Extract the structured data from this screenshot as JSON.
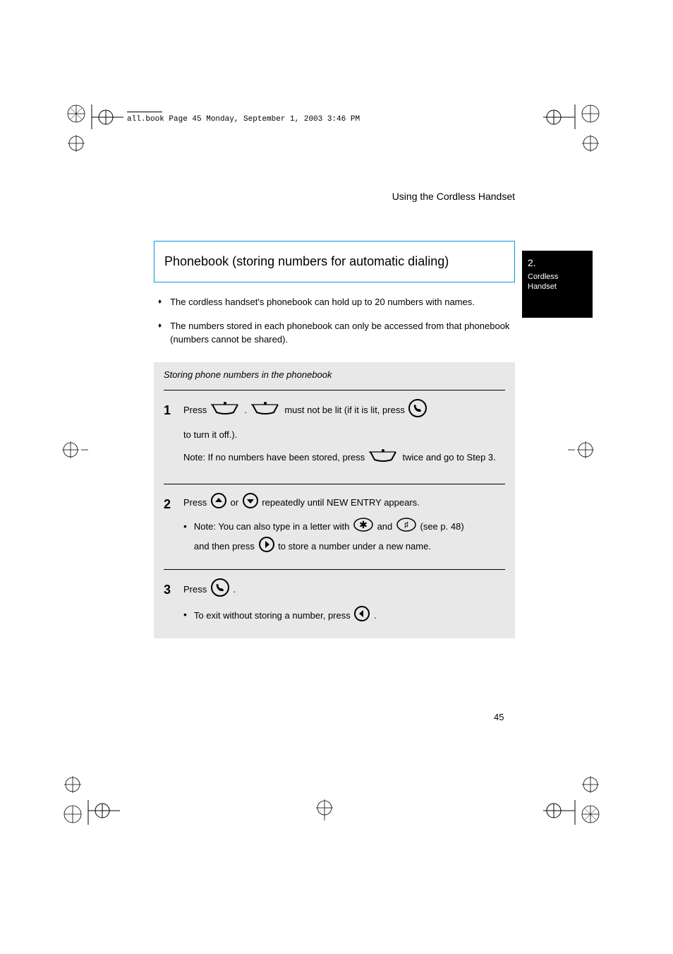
{
  "header": {
    "file_line": "all.book  Page 45  Monday, September 1, 2003  3:46 PM"
  },
  "running_header": "Using the Cordless Handset",
  "side_tab": {
    "number": "2.",
    "text": "Cordless Handset"
  },
  "section_title": "Phonebook (storing numbers for automatic dialing)",
  "bullets": [
    "The cordless handset's phonebook can hold up to 20 numbers with names.",
    "The numbers stored in each phonebook can only be accessed from that phonebook (numbers cannot be shared)."
  ],
  "gray_section": {
    "title": "Storing phone numbers in the phonebook",
    "step1": {
      "line1_a": "Press ",
      "line1_b": " .  ",
      "line1_c": " must not be lit (if it is lit, press ",
      "line1_d": "to turn it off.).",
      "line2_a": "Note: If no numbers have been stored, press ",
      "line2_b": " twice and go to Step 3."
    },
    "step2": {
      "line1_a": "Press ",
      "line1_b": " or ",
      "line1_c": " repeatedly until NEW ENTRY appears.",
      "sub_a": "Note: You can also type in a letter with ",
      "sub_b": " and ",
      "sub_c": " (see p. 48)",
      "sub2_a": "and then press ",
      "sub2_b": " to store a number under a new name."
    },
    "step3": {
      "line1_a": "Press ",
      "line1_b": ".",
      "sub_a": "To exit without storing a number, press ",
      "sub_b": "."
    }
  },
  "page_number": "45",
  "icons": {
    "phonebook": "phonebook-button",
    "talk": "talk-button",
    "up": "up-arrow",
    "down": "down-arrow",
    "star": "star-key",
    "hash": "hash-key",
    "right": "right-arrow",
    "left": "left-arrow"
  }
}
